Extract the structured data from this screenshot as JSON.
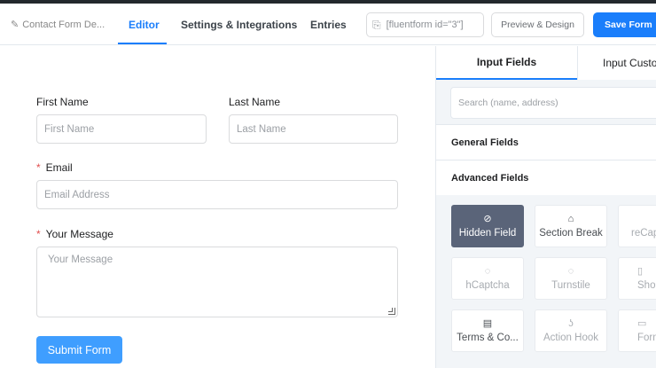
{
  "header": {
    "form_title": "Contact Form De...",
    "tabs": [
      "Editor",
      "Settings & Integrations",
      "Entries"
    ],
    "shortcode": "[fluentform id=\"3\"]",
    "preview_label": "Preview & Design",
    "save_label": "Save Form",
    "accent_color": "#1a7efb"
  },
  "form": {
    "first_name": {
      "label": "First Name",
      "placeholder": "First Name"
    },
    "last_name": {
      "label": "Last Name",
      "placeholder": "Last Name"
    },
    "email": {
      "required_mark": "*",
      "label": "Email",
      "placeholder": "Email Address"
    },
    "message": {
      "required_mark": "*",
      "label": "Your Message",
      "placeholder": "Your Message"
    },
    "submit_label": "Submit Form"
  },
  "panel": {
    "tabs": [
      "Input Fields",
      "Input Customization"
    ],
    "search_placeholder": "Search (name, address)",
    "sections": [
      "General Fields",
      "Advanced Fields"
    ],
    "fields": [
      {
        "label": "Hidden Field",
        "icon": "eye-slash-icon",
        "glyph": "⊘"
      },
      {
        "label": "Section Break",
        "icon": "section-break-icon",
        "glyph": "⌂"
      },
      {
        "label": "reCaptcha",
        "icon": "recaptcha-icon",
        "glyph": "◌"
      },
      {
        "label": "hCaptcha",
        "icon": "hcaptcha-icon",
        "glyph": "◌"
      },
      {
        "label": "Turnstile",
        "icon": "turnstile-icon",
        "glyph": "◌"
      },
      {
        "label": "Shortcode",
        "icon": "shortcode-icon",
        "glyph": "▯"
      },
      {
        "label": "Terms & Co...",
        "icon": "terms-icon",
        "glyph": "▤"
      },
      {
        "label": "Action Hook",
        "icon": "hook-icon",
        "glyph": "ʖ"
      },
      {
        "label": "Form Step",
        "icon": "form-step-icon",
        "glyph": "▭"
      }
    ]
  }
}
